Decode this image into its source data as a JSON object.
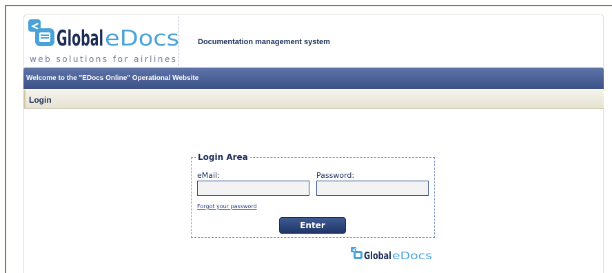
{
  "brand": {
    "logo_name_bold": "Global",
    "logo_name_light": "eDocs",
    "tagline": "web solutions for airlines",
    "colors": {
      "navy": "#1c2c57",
      "sky": "#4aa3d8",
      "bar": "#3b5187"
    }
  },
  "header": {
    "title": "Documentation management system"
  },
  "welcome_bar": {
    "text": "Welcome to the \"EDocs Online\" Operational Website"
  },
  "section": {
    "title": "Login"
  },
  "login_area": {
    "legend": "Login Area",
    "email_label": "eMail:",
    "email_value": "",
    "password_label": "Password:",
    "password_value": "",
    "forgot_link": "Forgot your password",
    "enter_button": "Enter"
  },
  "icons": [
    "airplane-icon",
    "document-icon"
  ]
}
